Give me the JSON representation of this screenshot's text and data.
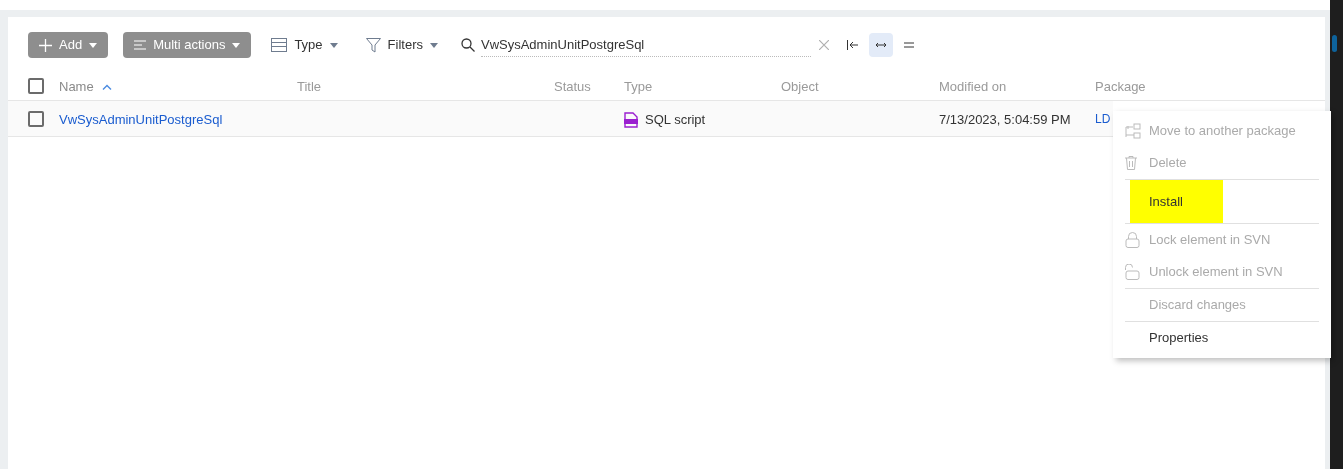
{
  "toolbar": {
    "buttons": [
      {
        "label": "Add",
        "kind": "primary"
      },
      {
        "label": "Multi actions",
        "kind": "primary"
      },
      {
        "label": "Type",
        "kind": "plain"
      },
      {
        "label": "Filters",
        "kind": "plain"
      }
    ],
    "search": {
      "value": "VwSysAdminUnitPostgreSql"
    },
    "view_modes": [
      {
        "selected": false
      },
      {
        "selected": true
      },
      {
        "selected": false
      }
    ]
  },
  "table": {
    "select_all": {
      "checked": false
    },
    "columns": [
      {
        "label": "Name",
        "sorted": true
      },
      {
        "label": "Title",
        "sorted": false
      },
      {
        "label": "Status",
        "sorted": false
      },
      {
        "label": "Type",
        "sorted": false
      },
      {
        "label": "Object",
        "sorted": false
      },
      {
        "label": "Modified on",
        "sorted": false
      },
      {
        "label": "Package",
        "sorted": false
      }
    ],
    "rows": [
      {
        "checked": false,
        "name": "VwSysAdminUnitPostgreSql",
        "title": "",
        "status": "",
        "type": "SQL script",
        "object": "",
        "modified_on": "7/13/2023, 5:04:59 PM",
        "package": "LD"
      }
    ]
  },
  "context_menu": {
    "items": [
      {
        "label": "Move to another package",
        "disabled": true,
        "highlighted": false,
        "divider_before": false
      },
      {
        "label": "Delete",
        "disabled": true,
        "highlighted": false,
        "divider_before": false
      },
      {
        "label": "Install",
        "disabled": false,
        "highlighted": true,
        "divider_before": true
      },
      {
        "label": "Lock element in SVN",
        "disabled": true,
        "highlighted": false,
        "divider_before": true
      },
      {
        "label": "Unlock element in SVN",
        "disabled": true,
        "highlighted": false,
        "divider_before": false
      },
      {
        "label": "Discard changes",
        "disabled": true,
        "highlighted": false,
        "divider_before": true
      },
      {
        "label": "Properties",
        "disabled": false,
        "highlighted": false,
        "divider_before": true
      }
    ]
  }
}
